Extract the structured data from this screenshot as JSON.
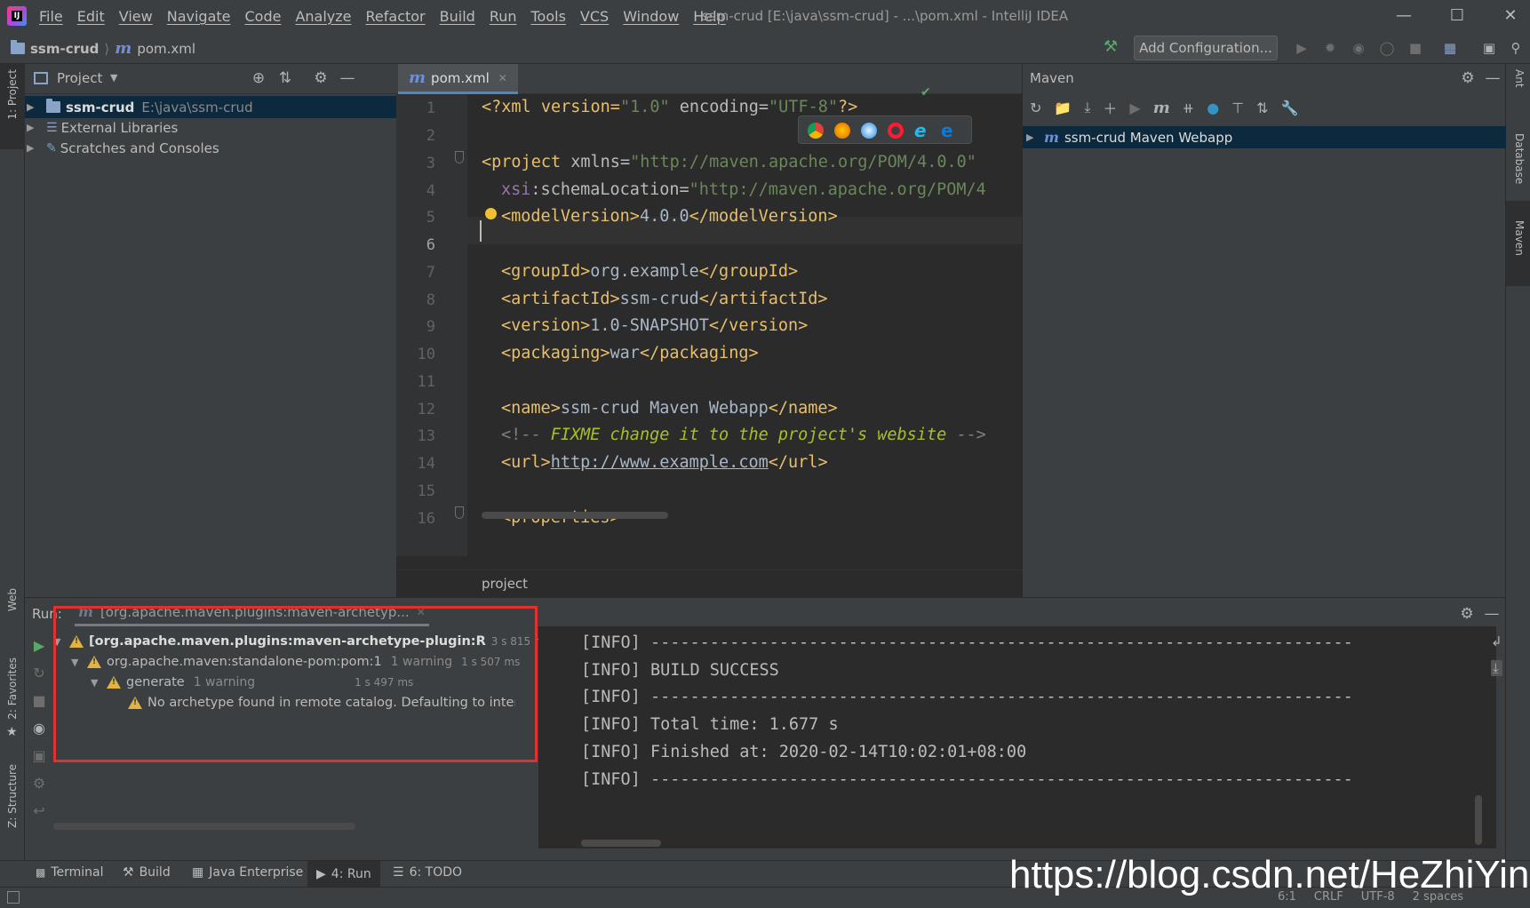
{
  "titlebar": {
    "menu": [
      "File",
      "Edit",
      "View",
      "Navigate",
      "Code",
      "Analyze",
      "Refactor",
      "Build",
      "Run",
      "Tools",
      "VCS",
      "Window",
      "Help"
    ],
    "title": "ssm-crud [E:\\java\\ssm-crud] - ...\\pom.xml - IntelliJ IDEA"
  },
  "navbar": {
    "project": "ssm-crud",
    "file": "pom.xml",
    "add_config": "Add Configuration..."
  },
  "left_strip": {
    "project": "1: Project",
    "web": "Web",
    "favorites": "2: Favorites",
    "structure": "Z: Structure"
  },
  "right_strip": {
    "ant": "Ant",
    "database": "Database",
    "maven": "Maven"
  },
  "project_panel": {
    "title": "Project",
    "items": [
      {
        "label": "ssm-crud",
        "path": "E:\\java\\ssm-crud"
      },
      {
        "label": "External Libraries"
      },
      {
        "label": "Scratches and Consoles"
      }
    ]
  },
  "editor": {
    "tab": "pom.xml",
    "breadcrumb": "project",
    "line_numbers": [
      "1",
      "2",
      "3",
      "4",
      "5",
      "6",
      "7",
      "8",
      "9",
      "10",
      "11",
      "12",
      "13",
      "14",
      "15",
      "16"
    ],
    "lines": {
      "l1a": "<?xml version=",
      "l1b": "\"1.0\"",
      "l1c": " encoding=",
      "l1d": "\"UTF-8\"",
      "l1e": "?>",
      "l3a": "<project ",
      "l3b": "xmlns=",
      "l3c": "\"http://maven.apache.org/POM/4.0.0\"",
      "l4a": "xsi",
      "l4b": ":schemaLocation=",
      "l4c": "\"http://maven.apache.org/POM/4",
      "l5a": "<modelVersion>",
      "l5b": "4.0.0",
      "l5c": "</modelVersion>",
      "l7a": "<groupId>",
      "l7b": "org.example",
      "l7c": "</groupId>",
      "l8a": "<artifactId>",
      "l8b": "ssm-crud",
      "l8c": "</artifactId>",
      "l9a": "<version>",
      "l9b": "1.0-SNAPSHOT",
      "l9c": "</version>",
      "l10a": "<packaging>",
      "l10b": "war",
      "l10c": "</packaging>",
      "l12a": "<name>",
      "l12b": "ssm-crud Maven Webapp",
      "l12c": "</name>",
      "l13a": "<!-- ",
      "l13b": "FIXME change it to the project's website",
      "l13c": " -->",
      "l14a": "<url>",
      "l14b": "http://www.example.com",
      "l14c": "</url>",
      "l16a": "<properties>"
    }
  },
  "maven": {
    "title": "Maven",
    "project": "ssm-crud Maven Webapp"
  },
  "run": {
    "label": "Run:",
    "tab": "[org.apache.maven.plugins:maven-archetyp...",
    "tree": [
      {
        "label": "[org.apache.maven.plugins:maven-archetype-plugin:R",
        "time": "3 s 815 ms"
      },
      {
        "label": "org.apache.maven:standalone-pom:pom:1",
        "note": "1 warning",
        "time": "1 s 507 ms"
      },
      {
        "label": "generate",
        "note": "1 warning",
        "time": "1 s 497 ms"
      },
      {
        "label": "No archetype found in remote catalog. Defaulting to inter"
      }
    ],
    "console": [
      "[INFO] -----------------------------------------------------------------------",
      "[INFO] BUILD SUCCESS",
      "[INFO] -----------------------------------------------------------------------",
      "[INFO] Total time: 1.677 s",
      "[INFO] Finished at: 2020-02-14T10:02:01+08:00",
      "[INFO] -----------------------------------------------------------------------"
    ]
  },
  "bottom_tabs": [
    "Terminal",
    "Build",
    "Java Enterprise",
    "4: Run",
    "6: TODO"
  ],
  "status": {
    "pos": "6:1",
    "crlf": "CRLF",
    "enc": "UTF-8",
    "indent": "2 spaces"
  },
  "watermark": "https://blog.csdn.net/HeZhiYing",
  "colors": {
    "accent": "#4a88c7",
    "highlight_box": "#e0302f",
    "selection": "#0d293e"
  }
}
